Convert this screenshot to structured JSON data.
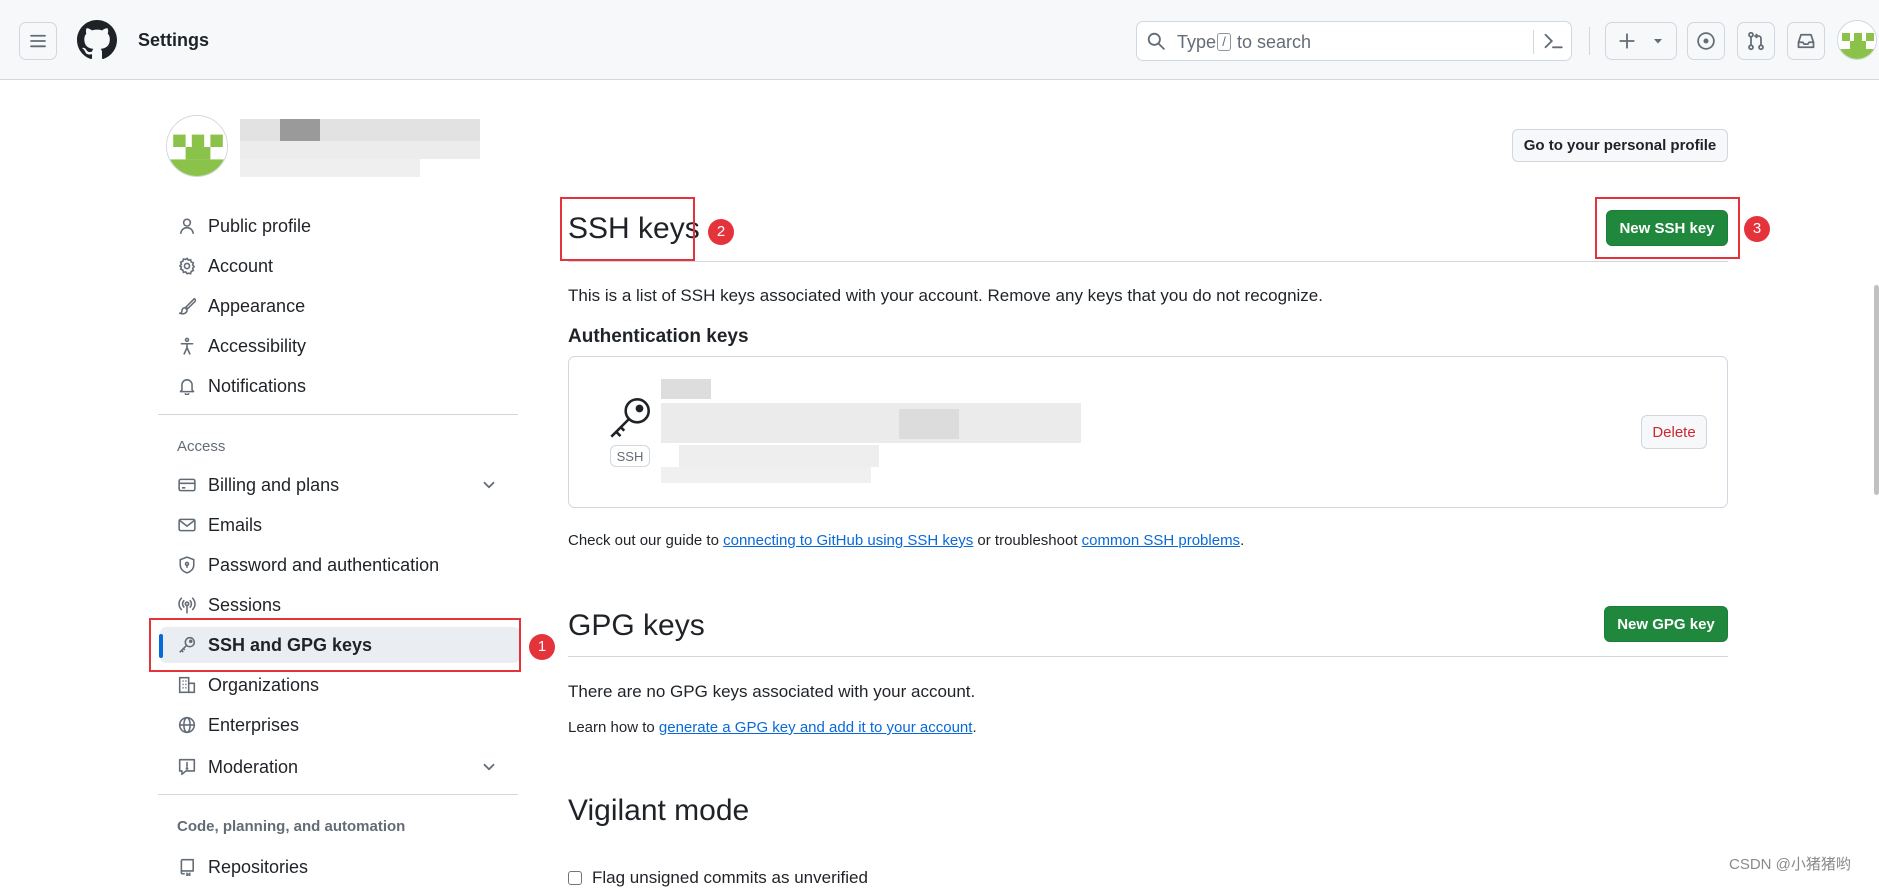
{
  "topbar": {
    "context_title": "Settings",
    "search": {
      "prefix": "Type",
      "key": "/",
      "suffix": "to search"
    }
  },
  "sidebar": {
    "personal_items": [
      {
        "label": "Public profile",
        "icon": "person-icon"
      },
      {
        "label": "Account",
        "icon": "gear-icon"
      },
      {
        "label": "Appearance",
        "icon": "paintbrush-icon"
      },
      {
        "label": "Accessibility",
        "icon": "accessibility-icon"
      },
      {
        "label": "Notifications",
        "icon": "bell-icon"
      }
    ],
    "access_heading": "Access",
    "access_items": [
      {
        "label": "Billing and plans",
        "icon": "credit-card-icon"
      },
      {
        "label": "Emails",
        "icon": "mail-icon"
      },
      {
        "label": "Password and authentication",
        "icon": "shield-lock-icon"
      },
      {
        "label": "Sessions",
        "icon": "broadcast-icon"
      },
      {
        "label": "SSH and GPG keys",
        "icon": "key-icon"
      },
      {
        "label": "Organizations",
        "icon": "organization-icon"
      },
      {
        "label": "Enterprises",
        "icon": "globe-icon"
      },
      {
        "label": "Moderation",
        "icon": "report-icon"
      }
    ],
    "code_heading": "Code, planning, and automation",
    "code_items": [
      {
        "label": "Repositories",
        "icon": "repo-icon"
      }
    ]
  },
  "main": {
    "profile_button": "Go to your personal profile",
    "ssh": {
      "title": "SSH keys",
      "new_button": "New SSH key",
      "description": "This is a list of SSH keys associated with your account. Remove any keys that you do not recognize.",
      "auth_heading": "Authentication keys",
      "key_type": "SSH",
      "delete_button": "Delete",
      "guide_prefix": "Check out our guide to",
      "guide_link1": "connecting to GitHub using SSH keys",
      "guide_middle": "or troubleshoot",
      "guide_link2": "common SSH problems",
      "guide_end": "."
    },
    "gpg": {
      "title": "GPG keys",
      "new_button": "New GPG key",
      "empty": "There are no GPG keys associated with your account.",
      "learn_prefix": "Learn how to",
      "learn_link": "generate a GPG key and add it to your account",
      "learn_end": "."
    },
    "vigilant": {
      "title": "Vigilant mode",
      "checkbox_label": "Flag unsigned commits as unverified"
    }
  },
  "annotations": {
    "badge1": "1",
    "badge2": "2",
    "badge3": "3"
  },
  "watermark": "CSDN @小猪猪哟",
  "colors": {
    "primary_green": "#1f883d",
    "link_blue": "#0969da",
    "annotation_red": "#e5333b",
    "danger": "#d1242f"
  }
}
